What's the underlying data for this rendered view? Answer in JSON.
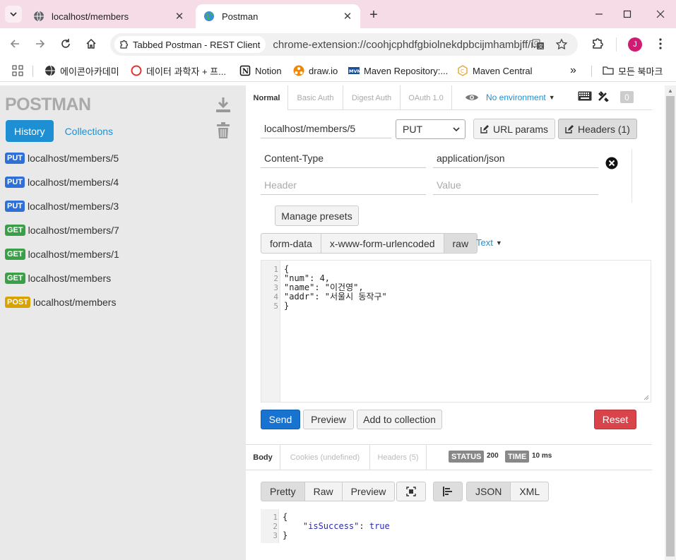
{
  "browser": {
    "tabs": [
      {
        "title": "localhost/members",
        "active": false
      },
      {
        "title": "Postman",
        "active": true
      }
    ],
    "site_chip": "Tabbed Postman - REST Client",
    "url": "chrome-extension://coohjcphdfgbiolnekdpbcijmhambjff/i...",
    "profile_initial": "J",
    "bookmarks": [
      "에이콘아카데미",
      "데이터 과학자 + 프...",
      "Notion",
      "draw.io",
      "Maven Repository:...",
      "Maven Central"
    ],
    "bookmarks_folder": "모든 북마크",
    "more_bookmarks": "»"
  },
  "sidebar": {
    "logo": "POSTMAN",
    "tabs": [
      "History",
      "Collections"
    ],
    "history": [
      {
        "method": "PUT",
        "url": "localhost/members/5",
        "color": "#2e6fd8"
      },
      {
        "method": "PUT",
        "url": "localhost/members/4",
        "color": "#2e6fd8"
      },
      {
        "method": "PUT",
        "url": "localhost/members/3",
        "color": "#2e6fd8"
      },
      {
        "method": "GET",
        "url": "localhost/members/7",
        "color": "#3aa048"
      },
      {
        "method": "GET",
        "url": "localhost/members/1",
        "color": "#3aa048"
      },
      {
        "method": "GET",
        "url": "localhost/members",
        "color": "#3aa048"
      },
      {
        "method": "POST",
        "url": "localhost/members",
        "color": "#d8a300"
      }
    ]
  },
  "request": {
    "auth_tabs": [
      "Normal",
      "Basic Auth",
      "Digest Auth",
      "OAuth 1.0"
    ],
    "environment": "No environment",
    "counter": "0",
    "url": "localhost/members/5",
    "method": "PUT",
    "url_params_label": "URL params",
    "headers_label": "Headers (1)",
    "headers": [
      {
        "key": "Content-Type",
        "value": "application/json"
      }
    ],
    "header_placeholder": "Header",
    "value_placeholder": "Value",
    "manage_presets": "Manage presets",
    "body_modes": [
      "form-data",
      "x-www-form-urlencoded",
      "raw"
    ],
    "body_type": "Text",
    "body_lines": [
      "{",
      "\"num\": 4,",
      "\"name\": \"이건영\",",
      "\"addr\": \"서울시 동작구\"",
      "}"
    ],
    "send": "Send",
    "preview": "Preview",
    "add_to_collection": "Add to collection",
    "reset": "Reset"
  },
  "response": {
    "tabs": [
      "Body",
      "Cookies (undefined)",
      "Headers (5)"
    ],
    "status_label": "STATUS",
    "status_value": "200",
    "time_label": "TIME",
    "time_value": "10 ms",
    "views": [
      "Pretty",
      "Raw",
      "Preview"
    ],
    "formats": [
      "JSON",
      "XML"
    ],
    "body": {
      "open": "{",
      "key": "\"isSuccess\"",
      "sep": ": ",
      "value": "true",
      "close": "}"
    }
  }
}
